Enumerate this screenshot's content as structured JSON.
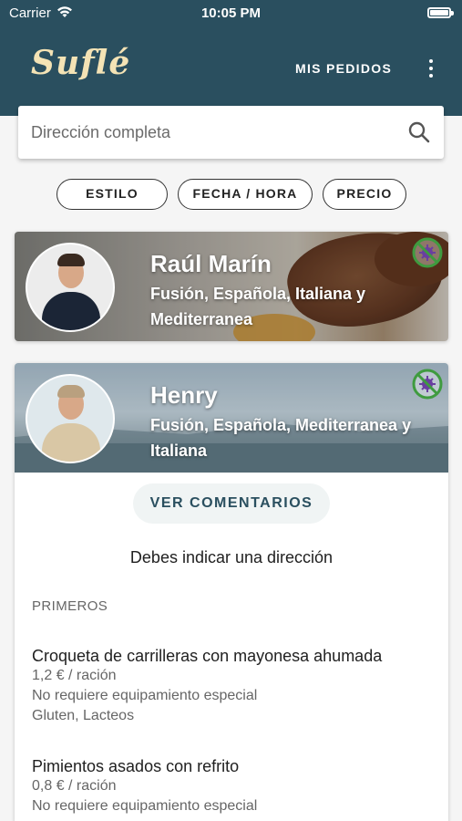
{
  "status_bar": {
    "carrier": "Carrier",
    "time": "10:05 PM"
  },
  "header": {
    "logo": "Suflé",
    "orders_label": "MIS PEDIDOS",
    "menu_icon": "more-vertical-icon"
  },
  "search": {
    "placeholder": "Dirección completa",
    "value": "",
    "icon": "search-icon"
  },
  "filters": [
    "ESTILO",
    "FECHA / HORA",
    "PRECIO"
  ],
  "chefs": [
    {
      "name": "Raúl Marín",
      "cuisines": "Fusión, Española, Italiana y Mediterranea",
      "badge_icon": "covid-free-icon"
    },
    {
      "name": "Henry",
      "cuisines": "Fusión, Española, Mediterranea y Italiana",
      "badge_icon": "covid-free-icon"
    }
  ],
  "details": {
    "comments_button": "VER COMENTARIOS",
    "address_message": "Debes indicar una dirección",
    "section_title": "PRIMEROS",
    "dishes": [
      {
        "name": "Croqueta de carrilleras con mayonesa ahumada",
        "price": "1,2 € / ración",
        "equipment": "No requiere equipamiento especial",
        "allergens": "Gluten, Lacteos"
      },
      {
        "name": "Pimientos asados con refrito",
        "price": "0,8 € / ración",
        "equipment": "No requiere equipamiento especial"
      }
    ]
  },
  "colors": {
    "app_bar": "#2a4f5f",
    "logo": "#f4e3b5",
    "badge_green": "#3f9b3f",
    "badge_purple": "#6a3fa0"
  }
}
